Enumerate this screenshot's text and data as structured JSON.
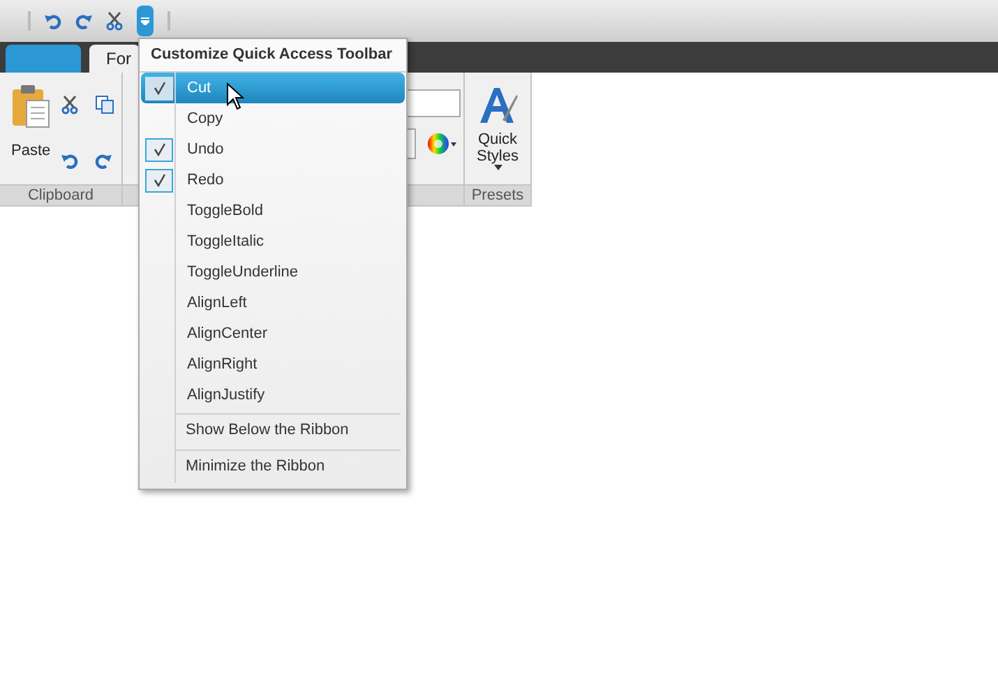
{
  "tabs": [
    {
      "kind": "file",
      "selected": false
    },
    {
      "label": "For",
      "kind": "tab",
      "selected": true
    }
  ],
  "ribbon": {
    "groups": [
      {
        "label": "Clipboard",
        "kind": "clipboard",
        "paste": "Paste"
      },
      {
        "kind": "font"
      },
      {
        "label": "Presets",
        "kind": "presets",
        "button": "Quick Styles"
      }
    ]
  },
  "menu": {
    "title": "Customize Quick Access Toolbar",
    "items": [
      {
        "label": "Cut",
        "kind": "check",
        "checked": true,
        "highlighted": true
      },
      {
        "label": "Copy",
        "kind": "check",
        "checked": false,
        "highlighted": false
      },
      {
        "label": "Undo",
        "kind": "check",
        "checked": true,
        "highlighted": false
      },
      {
        "label": "Redo",
        "kind": "check",
        "checked": true,
        "highlighted": false
      },
      {
        "label": "ToggleBold",
        "kind": "check",
        "checked": false,
        "highlighted": false
      },
      {
        "label": "ToggleItalic",
        "kind": "check",
        "checked": false,
        "highlighted": false
      },
      {
        "label": "ToggleUnderline",
        "kind": "check",
        "checked": false,
        "highlighted": false
      },
      {
        "label": "AlignLeft",
        "kind": "check",
        "checked": false,
        "highlighted": false
      },
      {
        "label": "AlignCenter",
        "kind": "check",
        "checked": false,
        "highlighted": false
      },
      {
        "label": "AlignRight",
        "kind": "check",
        "checked": false,
        "highlighted": false
      },
      {
        "label": "AlignJustify",
        "kind": "check",
        "checked": false,
        "highlighted": false
      },
      {
        "label": "Show Below the Ribbon",
        "kind": "command",
        "highlighted": false
      },
      {
        "label": "Minimize the Ribbon",
        "kind": "command",
        "highlighted": false
      }
    ]
  }
}
